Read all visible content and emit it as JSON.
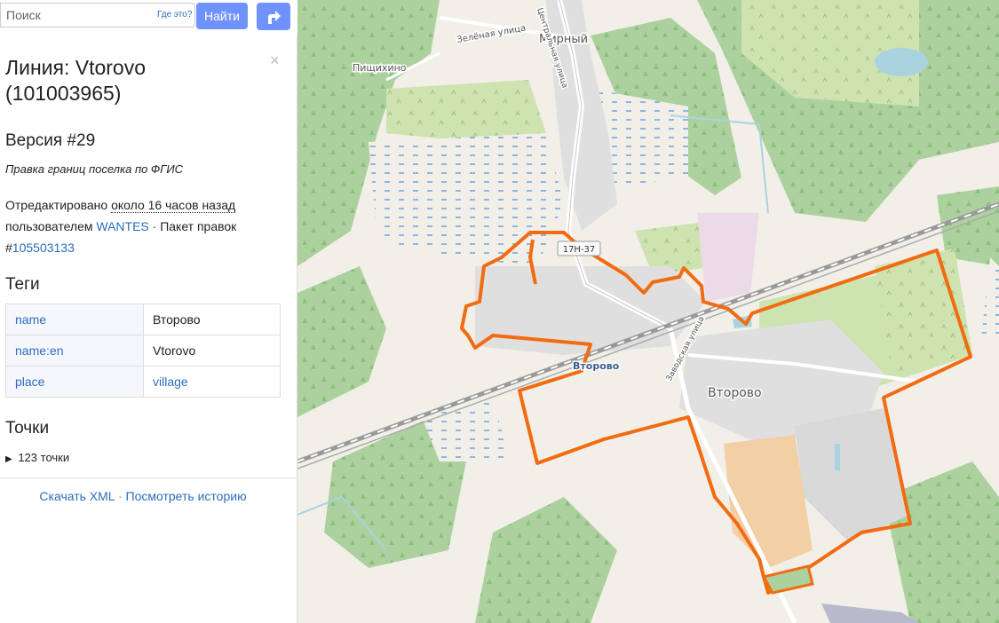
{
  "search": {
    "placeholder": "Поиск",
    "where_label": "Где это?",
    "submit_label": "Найти"
  },
  "feature": {
    "title": "Линия: Vtorovo (101003965)",
    "version": "Версия #29",
    "comment": "Правка границ поселка по ФГИС",
    "edited_prefix": "Отредактировано ",
    "edited_time": "около 16 часов назад",
    "by_label": "пользователем ",
    "user": "WANTES",
    "changeset_label": " · Пакет правок #",
    "changeset": "105503133"
  },
  "tags_heading": "Теги",
  "tags": [
    {
      "key": "name",
      "value": "Второво"
    },
    {
      "key": "name:en",
      "value": "Vtorovo"
    },
    {
      "key": "place",
      "value": "village"
    }
  ],
  "nodes_heading": "Точки",
  "nodes_summary": "123 точки",
  "footer": {
    "download": "Скачать XML",
    "separator": " · ",
    "history": "Посмотреть историю"
  },
  "map": {
    "labels": {
      "mirny": "Мирный",
      "zelenaya": "Зелёная улица",
      "pishchikhino": "Пищихино",
      "road": "17Н-37",
      "vtorovo_station": "Второво",
      "vtorovo": "Второво",
      "street_1": "Заводская улица",
      "street_2": "Центральная улица"
    },
    "colors": {
      "boundary": "#f26b10",
      "forest": "#add19e",
      "residential": "#e0dfdf",
      "farmland": "#eef0d5",
      "industrial": "#ebdbe8",
      "water": "#aad3df"
    }
  }
}
